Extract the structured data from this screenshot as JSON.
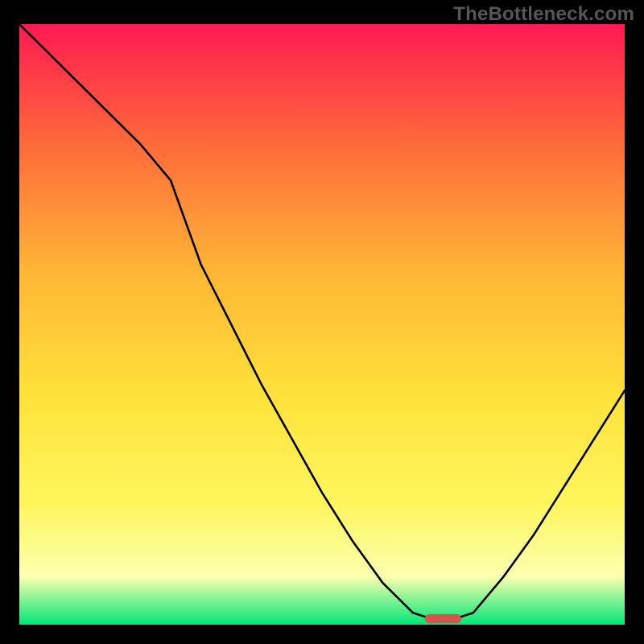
{
  "watermark": "TheBottleneck.com",
  "colors": {
    "frame": "#000000",
    "gradient_top": "#ff1a52",
    "gradient_mid1": "#ff6a3a",
    "gradient_mid2": "#ffb836",
    "gradient_mid3": "#ffe23a",
    "gradient_mid4": "#fff65e",
    "gradient_mid5": "#fcffb0",
    "gradient_bottom": "#00e676",
    "curve": "#000000",
    "marker": "#d9534f"
  },
  "chart_data": {
    "type": "line",
    "title": "",
    "xlabel": "",
    "ylabel": "",
    "xlim": [
      0,
      100
    ],
    "ylim": [
      0,
      100
    ],
    "x": [
      0,
      5,
      10,
      15,
      20,
      25,
      30,
      35,
      40,
      45,
      50,
      55,
      60,
      65,
      68,
      72,
      75,
      80,
      85,
      90,
      95,
      100
    ],
    "values": [
      100,
      95,
      90,
      85,
      80,
      74,
      60,
      50,
      40,
      31,
      22,
      14,
      7,
      2,
      1,
      1,
      2,
      8,
      15,
      23,
      31,
      39
    ],
    "marker": {
      "x": 70,
      "y": 1,
      "width": 6,
      "height": 1.5
    },
    "annotations": []
  }
}
